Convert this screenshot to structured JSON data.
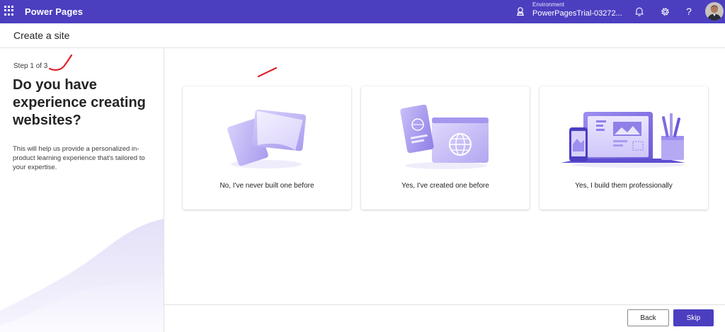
{
  "topbar": {
    "app_title": "Power Pages",
    "environment_label": "Environment",
    "environment_name": "PowerPagesTrial-03272...",
    "help_glyph": "?",
    "icons": [
      "waffle-icon",
      "environment-icon",
      "bell-icon",
      "gear-icon",
      "help-icon",
      "avatar"
    ],
    "background_color": "#4b3fc0"
  },
  "page": {
    "title": "Create a site"
  },
  "left_panel": {
    "step": "Step 1 of 3",
    "question": "Do you have experience creating websites?",
    "description": "This will help us provide a personalized in-product learning experience that's tailored to your expertise."
  },
  "options": [
    {
      "label": "No, I've never built one before",
      "illustration": "blank-pages-illustration"
    },
    {
      "label": "Yes, I've created one before",
      "illustration": "globe-pages-illustration"
    },
    {
      "label": "Yes, I build them professionally",
      "illustration": "laptop-design-illustration"
    }
  ],
  "footer": {
    "back_label": "Back",
    "skip_label": "Skip"
  },
  "colors": {
    "accent": "#4b3fc0",
    "annotation": "#e0202a"
  }
}
